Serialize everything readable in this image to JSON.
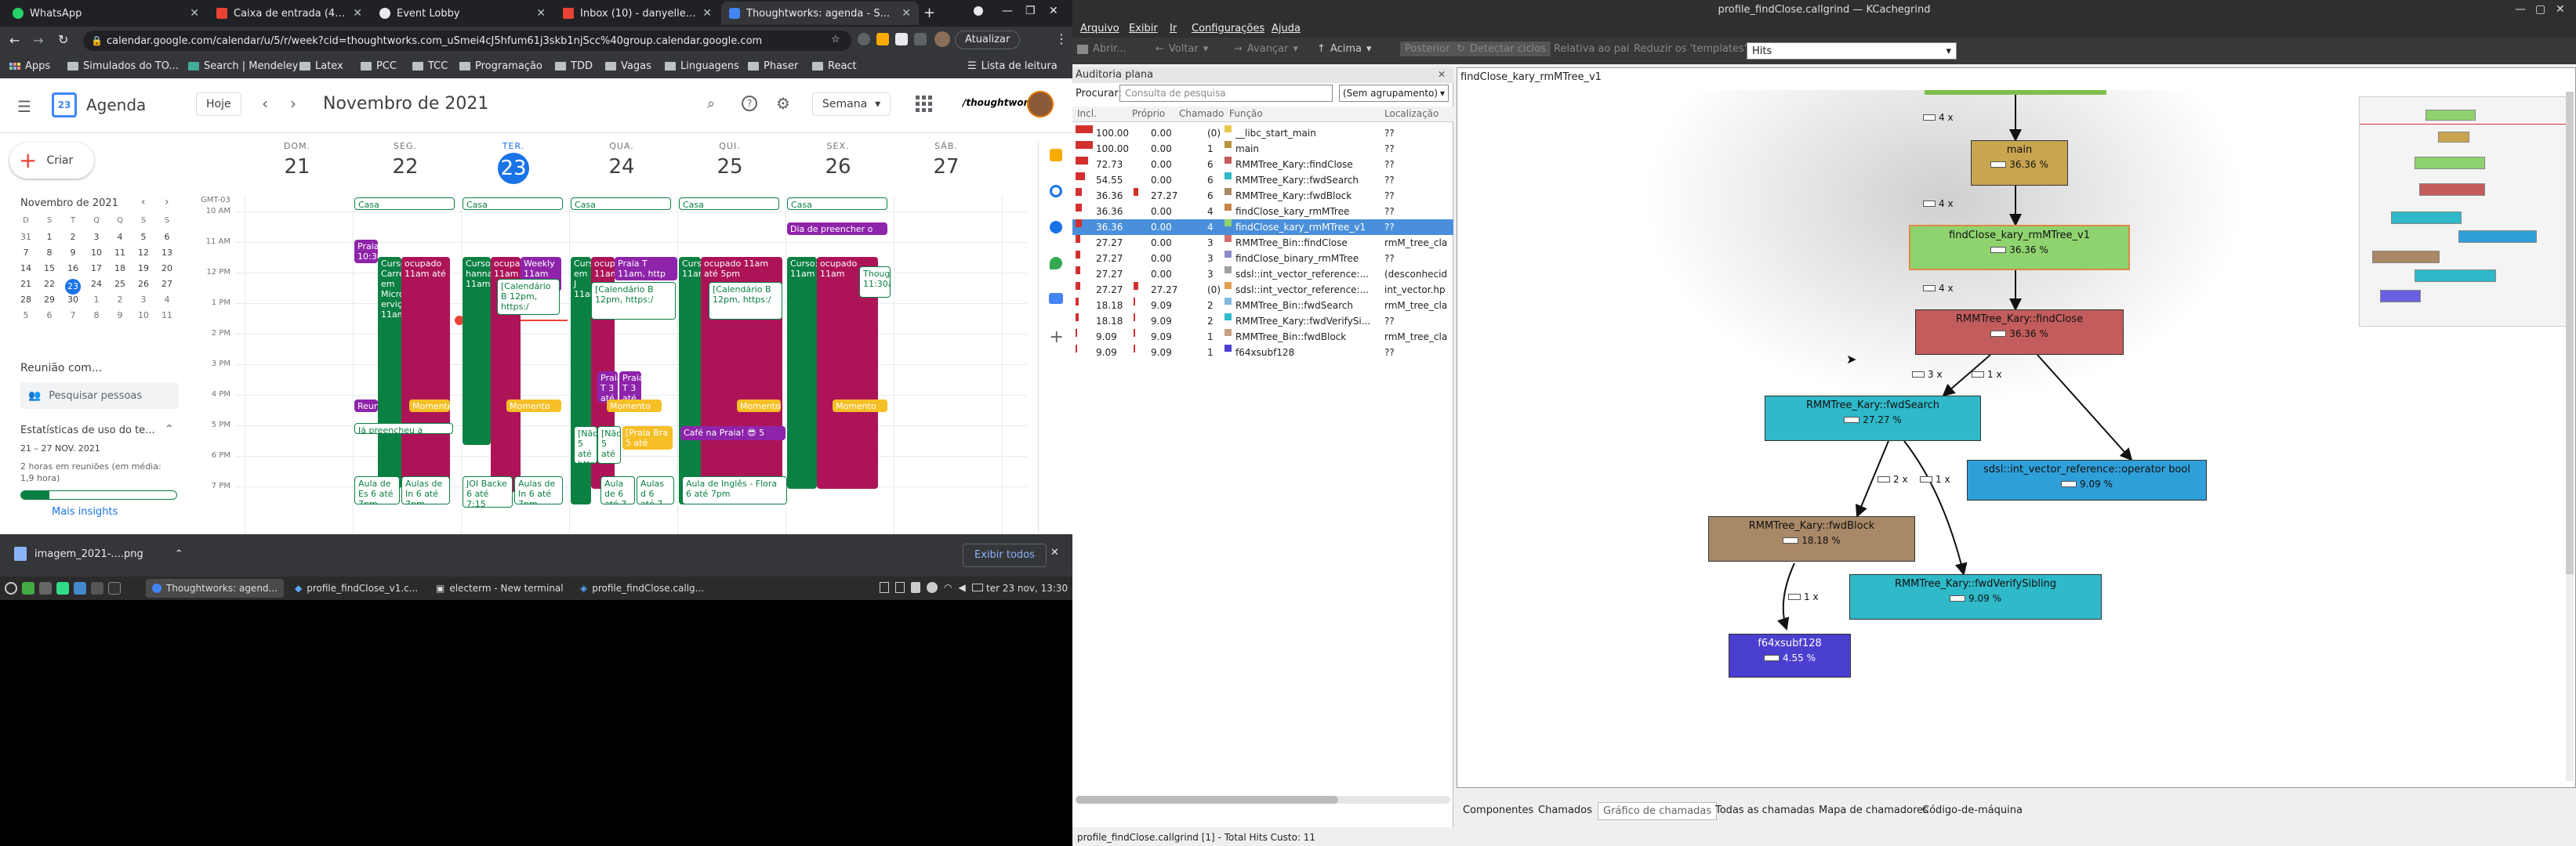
{
  "browser": {
    "tabs": [
      {
        "title": "WhatsApp",
        "color": "#25d366"
      },
      {
        "title": "Caixa de entrada (43) - dan...",
        "color": "#ea4335"
      },
      {
        "title": "Event Lobby",
        "color": "#e8eaed"
      },
      {
        "title": "Inbox (10) - danyelle.angel...",
        "color": "#ea4335"
      },
      {
        "title": "Thoughtworks: agenda - S...",
        "color": "#4285f4"
      }
    ],
    "url": "calendar.google.com/calendar/u/5/r/week?cid=thoughtworks.com_uSmei4cJ5hfum61j3skb1njScc%40group.calendar.google.com",
    "update_label": "Atualizar",
    "bookmarks": [
      "Apps",
      "Simulados do TO...",
      "Search | Mendeley",
      "Latex",
      "PCC",
      "TCC",
      "Programação",
      "TDD",
      "Vagas",
      "Linguagens",
      "Phaser",
      "React"
    ],
    "reading_list": "Lista de leitura"
  },
  "calendar": {
    "app_name": "Agenda",
    "today_btn": "Hoje",
    "month_title": "Novembro de 2021",
    "view_select": "Semana",
    "brand": "/thoughtworks",
    "create_btn": "Criar",
    "mini_month": "Novembro de 2021",
    "mini_dow": [
      "D",
      "S",
      "T",
      "Q",
      "Q",
      "S",
      "S"
    ],
    "mini_weeks": [
      [
        "31",
        "1",
        "2",
        "3",
        "4",
        "5",
        "6"
      ],
      [
        "7",
        "8",
        "9",
        "10",
        "11",
        "12",
        "13"
      ],
      [
        "14",
        "15",
        "16",
        "17",
        "18",
        "19",
        "20"
      ],
      [
        "21",
        "22",
        "23",
        "24",
        "25",
        "26",
        "27"
      ],
      [
        "28",
        "29",
        "30",
        "1",
        "2",
        "3",
        "4"
      ],
      [
        "5",
        "6",
        "7",
        "8",
        "9",
        "10",
        "11"
      ]
    ],
    "meet_title": "Reunião com...",
    "people_search": "Pesquisar pessoas",
    "stats_title": "Estatísticas de uso do te...",
    "stats_range": "21 – 27 NOV. 2021",
    "stats_text": "2 horas em reuniões (em média: 1,9 hora)",
    "more_insights": "Mais insights",
    "tz": "GMT-03",
    "days": [
      {
        "dow": "DOM.",
        "num": "21"
      },
      {
        "dow": "SEG.",
        "num": "22"
      },
      {
        "dow": "TER.",
        "num": "23"
      },
      {
        "dow": "QUA.",
        "num": "24"
      },
      {
        "dow": "QUI.",
        "num": "25"
      },
      {
        "dow": "SEX.",
        "num": "26"
      },
      {
        "dow": "SÁB.",
        "num": "27"
      }
    ],
    "times": [
      "10 AM",
      "11 AM",
      "12 PM",
      "1 PM",
      "2 PM",
      "3 PM",
      "4 PM",
      "5 PM",
      "6 PM",
      "7 PM"
    ],
    "allday": [
      "Casa",
      "Casa",
      "Casa",
      "Casa",
      "Casa"
    ],
    "allday_special": "Dia de preencher o",
    "events": {
      "praia1": "Praia 10:30",
      "curso_mon": "Curso Carrei em Micro erviç 11am",
      "ocupado_mon": "ocupado 11am até",
      "curso_tue": "Curso: hanna 11am",
      "ocupado_tue": "ocupad 11am",
      "weekly": "Weekly 11am",
      "cal_tue": "[Calendário B 12pm, https:/",
      "curso_wed": "Curso em J 11am",
      "ocupado_wed": "ocup 11am",
      "praia_wed": "Praia T 11am, http",
      "cal_wed": "[Calendário B 12pm, https:/",
      "praia_wed2": "Praia T 3 até 4",
      "praia_wed3": "Praia T 3 até 4p",
      "curso_thu": "Curso: 11am",
      "ocupado_thu": "ocupado 11am até 5pm",
      "cal_thu": "[Calendário B 12pm, https:/",
      "curso_fri": "Curso: 11am",
      "ocupado_fri": "ocupado 11am",
      "though_fri": "Thoug 11:30a",
      "momento1": "Momento",
      "momento2": "Momento pra",
      "momento3": "Momento pra",
      "momento4": "Momento pra",
      "momento5": "Momento pra",
      "reun": "Reun",
      "preencher": "Já preencheu a pesquisa",
      "nao1": "[Não 5 até http",
      "nao2": "[Não 5 até",
      "praia_bra": "[Praia Bra 5 até 6pm",
      "cafe": "Café na Praia! 😎 5",
      "aula1": "Aula de Es 6 até 7pm",
      "aula2": "Aulas de In 6 até 7pm",
      "jdi": "JOI Backe 6 até 7:15",
      "aula3": "Aulas de In 6 até 7pm",
      "aula4": "Aula de 6 até 7",
      "aula5": "Aulas d 6 até 7",
      "aula6": "Aula de Inglês - Flora 6 até 7pm"
    },
    "download_file": "imagem_2021-....png",
    "show_all": "Exibir todos"
  },
  "taskbar": {
    "items": [
      "Thoughtworks: agend...",
      "profile_findClose_v1.c...",
      "electerm - New terminal",
      "profile_findClose.callg..."
    ],
    "clock": "ter 23 nov, 13:30"
  },
  "kcachegrind": {
    "title": "profile_findClose.callgrind — KCachegrind",
    "menu": [
      "Arquivo",
      "Exibir",
      "Ir",
      "Configurações",
      "Ajuda"
    ],
    "toolbar": [
      "Abrir...",
      "Voltar",
      "Avançar",
      "Acima",
      "Posterior",
      "Detectar ciclos",
      "Relativa ao pai",
      "Reduzir os 'templates'"
    ],
    "event_select": "Hits",
    "flat_title": "Auditoria plana",
    "search_label": "Procurar:",
    "search_placeholder": "Consulta de pesquisa",
    "grouping": "(Sem agrupamento)",
    "columns": [
      "Incl.",
      "Próprio",
      "Chamado",
      "Função",
      "Localização"
    ],
    "rows": [
      {
        "incl": "100.00",
        "self": "0.00",
        "called": "(0)",
        "fn": "__libc_start_main",
        "loc": "??",
        "color": "#e8c84a"
      },
      {
        "incl": "100.00",
        "self": "0.00",
        "called": "1",
        "fn": "main",
        "loc": "??",
        "color": "#b8963e"
      },
      {
        "incl": "72.73",
        "self": "0.00",
        "called": "6",
        "fn": "RMMTree_Kary::findClose",
        "loc": "??",
        "color": "#c35c5c"
      },
      {
        "incl": "54.55",
        "self": "0.00",
        "called": "6",
        "fn": "RMMTree_Kary::fwdSearch",
        "loc": "??",
        "color": "#2fb9c9"
      },
      {
        "incl": "36.36",
        "self": "27.27",
        "called": "6",
        "fn": "RMMTree_Kary::fwdBlock",
        "loc": "??",
        "color": "#a88866"
      },
      {
        "incl": "36.36",
        "self": "0.00",
        "called": "4",
        "fn": "findClose_kary_rmMTree",
        "loc": "??",
        "color": "#c8844c"
      },
      {
        "incl": "36.36",
        "self": "0.00",
        "called": "4",
        "fn": "findClose_kary_rmMTree_v1",
        "loc": "??",
        "color": "#8fd36f"
      },
      {
        "incl": "27.27",
        "self": "0.00",
        "called": "3",
        "fn": "RMMTree_Bin::findClose",
        "loc": "rmM_tree_cla",
        "color": "#d26f6f"
      },
      {
        "incl": "27.27",
        "self": "0.00",
        "called": "3",
        "fn": "findClose_binary_rmMTree",
        "loc": "??",
        "color": "#8a8ac8"
      },
      {
        "incl": "27.27",
        "self": "0.00",
        "called": "3",
        "fn": "sdsl::int_vector_reference:...",
        "loc": "(desconhecid",
        "color": "#a1a1a1"
      },
      {
        "incl": "27.27",
        "self": "27.27",
        "called": "(0)",
        "fn": "sdsl::int_vector_reference:...",
        "loc": "int_vector.hp",
        "color": "#e0a050"
      },
      {
        "incl": "18.18",
        "self": "9.09",
        "called": "2",
        "fn": "RMMTree_Bin::fwdSearch",
        "loc": "rmM_tree_cla",
        "color": "#80b9e0"
      },
      {
        "incl": "18.18",
        "self": "9.09",
        "called": "2",
        "fn": "RMMTree_Kary::fwdVerifySi...",
        "loc": "??",
        "color": "#2fb9c9"
      },
      {
        "incl": "9.09",
        "self": "9.09",
        "called": "1",
        "fn": "RMMTree_Bin::fwdBlock",
        "loc": "rmM_tree_cla",
        "color": "#c8a080"
      },
      {
        "incl": "9.09",
        "self": "9.09",
        "called": "1",
        "fn": "f64xsubf128",
        "loc": "??",
        "color": "#4a3fcf"
      }
    ],
    "graph_title": "findClose_kary_rmMTree_v1",
    "nodes": {
      "main": {
        "name": "main",
        "pct": "36.36 %"
      },
      "fcv1": {
        "name": "findClose_kary_rmMTree_v1",
        "pct": "36.36 %"
      },
      "fc": {
        "name": "RMMTree_Kary::findClose",
        "pct": "36.36 %"
      },
      "fs": {
        "name": "RMMTree_Kary::fwdSearch",
        "pct": "27.27 %"
      },
      "ivr": {
        "name": "sdsl::int_vector_reference::operator bool",
        "pct": "9.09 %"
      },
      "fb": {
        "name": "RMMTree_Kary::fwdBlock",
        "pct": "18.18 %"
      },
      "fvs": {
        "name": "RMMTree_Kary::fwdVerifySibling",
        "pct": "9.09 %"
      },
      "f64": {
        "name": "f64xsubf128",
        "pct": "4.55 %"
      }
    },
    "edges": [
      "4 x",
      "4 x",
      "4 x",
      "3 x",
      "1 x",
      "2 x",
      "1 x",
      "1 x"
    ],
    "bottom_tabs": [
      "Componentes",
      "Chamados",
      "Gráfico de chamadas",
      "Todas as chamadas",
      "Mapa de chamadores",
      "Código-de-máquina"
    ],
    "status": "profile_findClose.callgrind [1] - Total Hits Custo: 11"
  }
}
